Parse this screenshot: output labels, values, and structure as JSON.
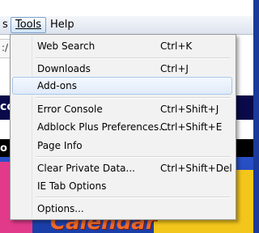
{
  "menubar": {
    "partial_label": "s",
    "tools_label": "Tools",
    "help_label": "Help"
  },
  "background": {
    "url_fragment": ":/",
    "banner_fragment": "cc",
    "black_band_fragment": "o",
    "calendar_text": "Calendar"
  },
  "tools_menu": {
    "items": [
      {
        "label": "Web Search",
        "shortcut": "Ctrl+K"
      },
      {
        "label": "Downloads",
        "shortcut": "Ctrl+J"
      },
      {
        "label": "Add-ons",
        "shortcut": ""
      },
      {
        "label": "Error Console",
        "shortcut": "Ctrl+Shift+J"
      },
      {
        "label": "Adblock Plus Preferences...",
        "shortcut": "Ctrl+Shift+E"
      },
      {
        "label": "Page Info",
        "shortcut": ""
      },
      {
        "label": "Clear Private Data...",
        "shortcut": "Ctrl+Shift+Del"
      },
      {
        "label": "IE Tab Options",
        "shortcut": ""
      },
      {
        "label": "Options...",
        "shortcut": ""
      }
    ],
    "hovered_item": "Add-ons"
  },
  "colors": {
    "hover_border": "#a8c8ec",
    "menu_bg": "#f2f2f2",
    "page_blue": "#1b3a9a"
  }
}
